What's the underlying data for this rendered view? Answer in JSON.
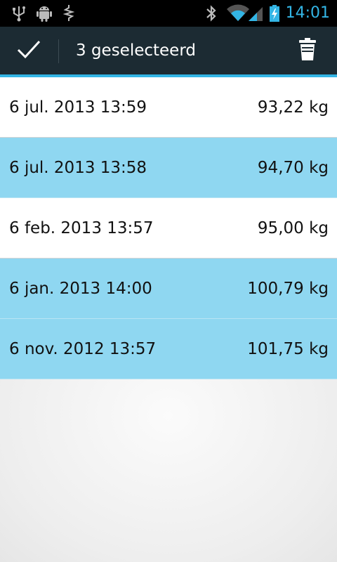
{
  "status_bar": {
    "time": "14:01",
    "left_icons": [
      "usb-icon",
      "android-debug-icon",
      "signal-trace-icon"
    ],
    "right_icons": [
      "bluetooth-icon",
      "wifi-icon",
      "cell-signal-icon",
      "battery-charging-icon"
    ],
    "accent_color": "#33b5e5"
  },
  "action_bar": {
    "title": "3 geselecteerd",
    "done_icon": "checkmark-icon",
    "delete_icon": "trash-icon",
    "background": "#1c2b33"
  },
  "list": {
    "selected_color": "#8fd7f1",
    "items": [
      {
        "date": "6 jul. 2013 13:59",
        "weight": "93,22 kg",
        "selected": false
      },
      {
        "date": "6 jul. 2013 13:58",
        "weight": "94,70 kg",
        "selected": true
      },
      {
        "date": "6 feb. 2013 13:57",
        "weight": "95,00 kg",
        "selected": false
      },
      {
        "date": "6 jan. 2013 14:00",
        "weight": "100,79 kg",
        "selected": true
      },
      {
        "date": "6 nov. 2012 13:57",
        "weight": "101,75 kg",
        "selected": true
      }
    ]
  }
}
